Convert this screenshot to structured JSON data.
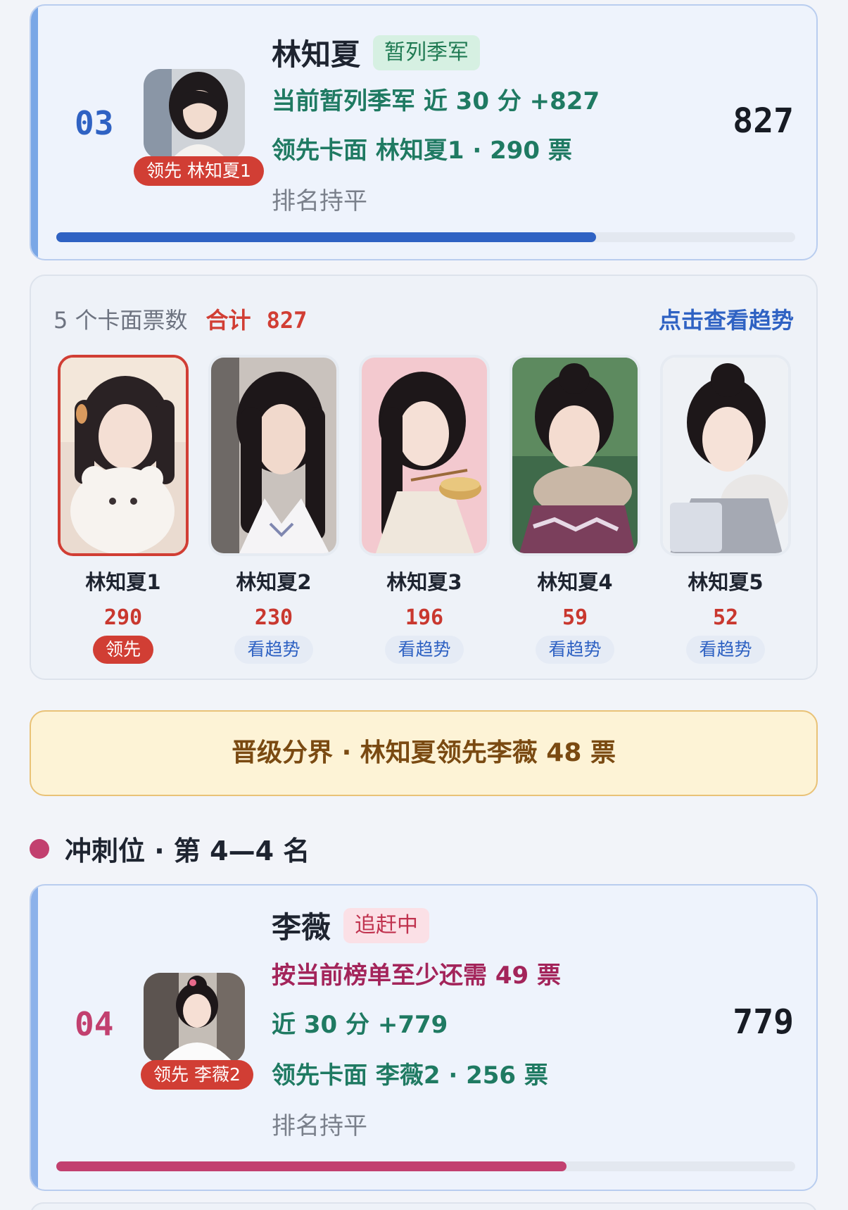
{
  "rank3": {
    "rank": "03",
    "name": "林知夏",
    "status": "暂列季军",
    "line1": "当前暂列季军  近 30 分 +827",
    "line2": "领先卡面 林知夏1 · 290 票",
    "line3": "排名持平",
    "total": "827",
    "avatar_tag": "领先 林知夏1",
    "progress": 0.73,
    "bar_color": "#2f62c3"
  },
  "cards_panel": {
    "count_label": "5 个卡面票数",
    "sum_label": "合计",
    "sum_value": "827",
    "trend_link": "点击查看趋势",
    "cards": [
      {
        "name": "林知夏1",
        "votes": "290",
        "button": "领先"
      },
      {
        "name": "林知夏2",
        "votes": "230",
        "button": "看趋势"
      },
      {
        "name": "林知夏3",
        "votes": "196",
        "button": "看趋势"
      },
      {
        "name": "林知夏4",
        "votes": "59",
        "button": "看趋势"
      },
      {
        "name": "林知夏5",
        "votes": "52",
        "button": "看趋势"
      }
    ]
  },
  "divider": {
    "text": "晋级分界 · 林知夏领先李薇 48 票"
  },
  "section": {
    "title": "冲刺位 · 第 4—4 名",
    "dot_color": "#c2406f"
  },
  "rank4": {
    "rank": "04",
    "name": "李薇",
    "status": "追赶中",
    "line1": "按当前榜单至少还需 49 票",
    "line2": "近 30 分 +779",
    "line3": "领先卡面 李薇2 · 256 票",
    "line4": "排名持平",
    "total": "779",
    "avatar_tag": "领先 李薇2",
    "progress": 0.69,
    "bar_color": "#c2406f"
  }
}
